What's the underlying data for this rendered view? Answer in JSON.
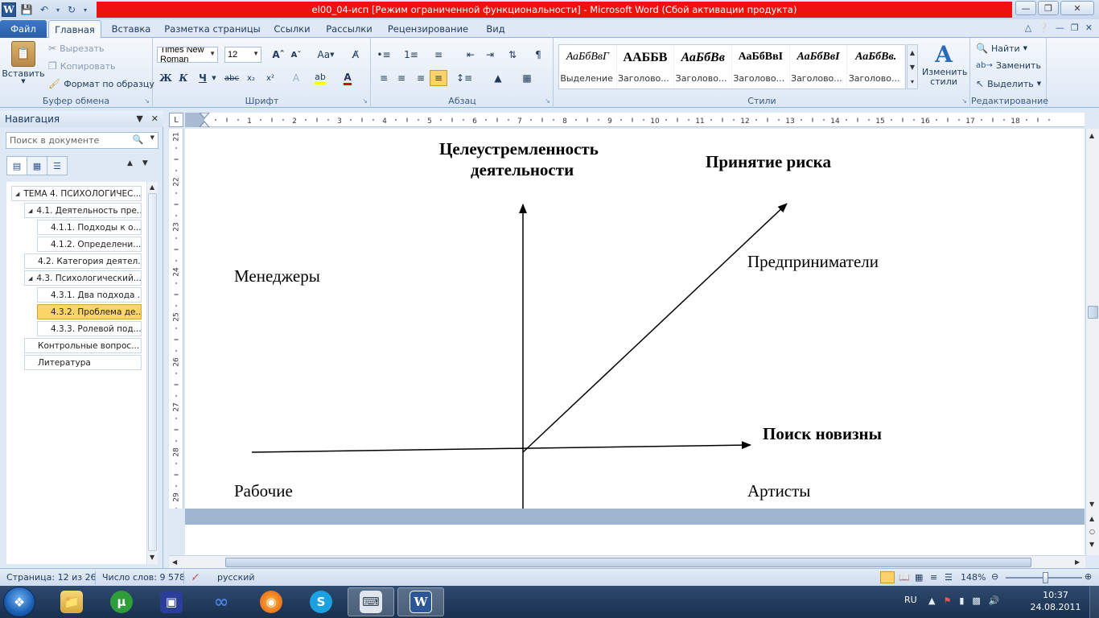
{
  "window": {
    "title": "el00_04-исп [Режим ограниченной функциональности]  -  Microsoft Word (Сбой активации продукта)",
    "word_letter": "W"
  },
  "tabs": {
    "file": "Файл",
    "items": [
      "Главная",
      "Вставка",
      "Разметка страницы",
      "Ссылки",
      "Рассылки",
      "Рецензирование",
      "Вид"
    ],
    "active": "Главная"
  },
  "ribbon": {
    "clipboard": {
      "label": "Буфер обмена",
      "paste": "Вставить",
      "cut": "Вырезать",
      "copy": "Копировать",
      "format_painter": "Формат по образцу"
    },
    "font": {
      "label": "Шрифт",
      "name": "Times New Roman",
      "size": "12",
      "case_label": "Aa"
    },
    "paragraph": {
      "label": "Абзац"
    },
    "styles": {
      "label": "Стили",
      "items": [
        {
          "sample": "АаБбВвГ",
          "name": "Выделение"
        },
        {
          "sample": "ААББВ",
          "name": "Заголово..."
        },
        {
          "sample": "АаБбВв",
          "name": "Заголово..."
        },
        {
          "sample": "АаБбВвІ",
          "name": "Заголово..."
        },
        {
          "sample": "АаБбВвІ",
          "name": "Заголово..."
        },
        {
          "sample": "АаБбВв.",
          "name": "Заголово..."
        }
      ],
      "change_styles": "Изменить стили"
    },
    "editing": {
      "label": "Редактирование",
      "find": "Найти",
      "replace": "Заменить",
      "select": "Выделить"
    }
  },
  "nav": {
    "title": "Навигация",
    "search_placeholder": "Поиск в документе",
    "items": [
      {
        "text": "ТЕМА 4. ПСИХОЛОГИЧЕС...",
        "level": 0,
        "expanded": true,
        "selected": false
      },
      {
        "text": "4.1. Деятельность пре...",
        "level": 1,
        "expanded": true,
        "selected": false
      },
      {
        "text": "4.1.1. Подходы к о...",
        "level": 2,
        "expanded": false,
        "selected": false
      },
      {
        "text": "4.1.2. Определени...",
        "level": 2,
        "expanded": false,
        "selected": false
      },
      {
        "text": "4.2. Категория деятел...",
        "level": 1,
        "expanded": false,
        "selected": false
      },
      {
        "text": "4.3. Психологический...",
        "level": 1,
        "expanded": true,
        "selected": false
      },
      {
        "text": "4.3.1. Два подхода ...",
        "level": 2,
        "expanded": false,
        "selected": false
      },
      {
        "text": "4.3.2. Проблема де...",
        "level": 2,
        "expanded": false,
        "selected": true
      },
      {
        "text": "4.3.3. Ролевой под...",
        "level": 2,
        "expanded": false,
        "selected": false
      },
      {
        "text": "Контрольные вопрос...",
        "level": 1,
        "expanded": false,
        "selected": false
      },
      {
        "text": "Литература",
        "level": 1,
        "expanded": false,
        "selected": false
      }
    ]
  },
  "ruler": {
    "h_numbers": [
      "1",
      "2",
      "3",
      "4",
      "5",
      "6",
      "7",
      "8",
      "9",
      "10",
      "11",
      "12",
      "13",
      "14",
      "15",
      "16",
      "17",
      "18"
    ],
    "v_numbers": [
      "21",
      "22",
      "23",
      "24",
      "25",
      "26",
      "27",
      "28",
      "29"
    ],
    "tab_marker": "L"
  },
  "document": {
    "axis_top_line1": "Целеустремленность",
    "axis_top_line2": "деятельности",
    "axis_diagonal": "Принятие риска",
    "axis_right": "Поиск новизны",
    "quadrant_top_left": "Менеджеры",
    "quadrant_top_right": "Предприниматели",
    "quadrant_bottom_left": "Рабочие",
    "quadrant_bottom_right": "Артисты"
  },
  "status": {
    "page": "Страница: 12 из 26",
    "words": "Число слов: 9 578",
    "language": "русский",
    "zoom": "148%"
  },
  "taskbar": {
    "apps": [
      "explorer",
      "utorrent",
      "save-disk",
      "infinity",
      "firefox",
      "skype",
      "keyboard",
      "word"
    ],
    "lang": "RU",
    "time": "10:37",
    "date": "24.08.2011"
  }
}
